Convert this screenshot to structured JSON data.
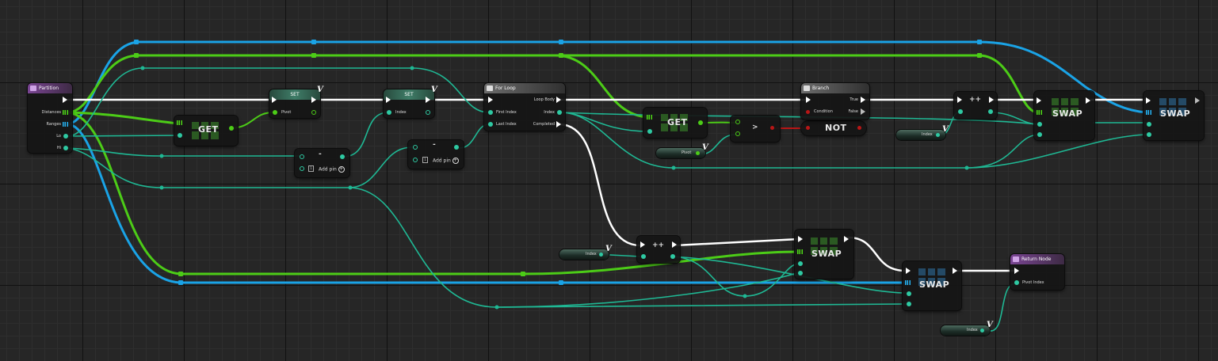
{
  "nodes": {
    "partition": {
      "title": "Partition",
      "pins": {
        "distances": "Distances",
        "ranges": "Ranges",
        "lo": "Lo",
        "hi": "Hi"
      }
    },
    "get1": {
      "title": "GET"
    },
    "set_pivot": {
      "title": "SET",
      "pin": "Pivot"
    },
    "set_index": {
      "title": "SET",
      "pin": "Index"
    },
    "subtract1": {
      "op": "-",
      "add_pin": "Add pin"
    },
    "subtract2": {
      "op": "-",
      "add_pin": "Add pin"
    },
    "for_loop": {
      "title": "For Loop",
      "pins": {
        "loop_body": "Loop Body",
        "first_index": "First Index",
        "last_index": "Last Index",
        "index": "Index",
        "completed": "Completed"
      }
    },
    "get2": {
      "title": "GET"
    },
    "pivot_var": {
      "label": "Pivot"
    },
    "greater": {
      "op": ">"
    },
    "not_node": {
      "title": "NOT"
    },
    "branch": {
      "title": "Branch",
      "pins": {
        "condition": "Condition",
        "true": "True",
        "false": "False"
      }
    },
    "incr1": {
      "op": "++"
    },
    "index_var1": {
      "label": "Index"
    },
    "swap1": {
      "title": "SWAP"
    },
    "swap2": {
      "title": "SWAP"
    },
    "index_var2": {
      "label": "Index"
    },
    "incr2": {
      "op": "++"
    },
    "swap3": {
      "title": "SWAP"
    },
    "swap4": {
      "title": "SWAP"
    },
    "return_node": {
      "title": "Return Node",
      "pin": "Pivot Index"
    },
    "index_var3": {
      "label": "Index"
    }
  },
  "var_marker": "V"
}
